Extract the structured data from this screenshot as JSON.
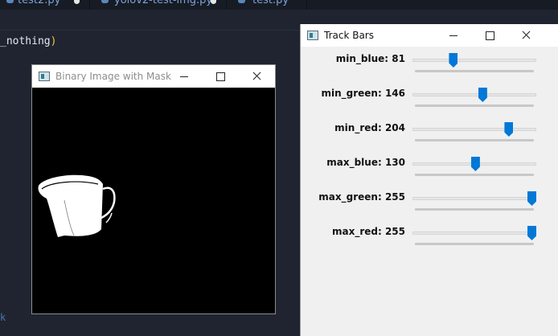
{
  "editor": {
    "tabs": [
      {
        "label": "test2.py",
        "modified": true
      },
      {
        "label": "yolov2-test-img.py",
        "modified": true
      },
      {
        "label": "test.py",
        "modified": false
      }
    ],
    "code_line": "_nothing",
    "code_paren": ")",
    "code_fragment": "k"
  },
  "binary_window": {
    "title": "Binary Image with Mask",
    "icon": "window-app-icon",
    "controls": [
      "minimize-icon",
      "maximize-icon",
      "close-icon"
    ]
  },
  "trackbar_window": {
    "title": "Track Bars",
    "icon": "window-app-icon",
    "controls": [
      "minimize-icon",
      "maximize-icon",
      "close-icon"
    ],
    "slider_max": 255,
    "accent": "#0078d7",
    "sliders": [
      {
        "label": "min_blue: 81",
        "value": 81
      },
      {
        "label": "min_green: 146",
        "value": 146
      },
      {
        "label": "min_red: 204",
        "value": 204
      },
      {
        "label": "max_blue: 130",
        "value": 130
      },
      {
        "label": "max_green: 255",
        "value": 255
      },
      {
        "label": "max_red: 255",
        "value": 255
      }
    ]
  }
}
